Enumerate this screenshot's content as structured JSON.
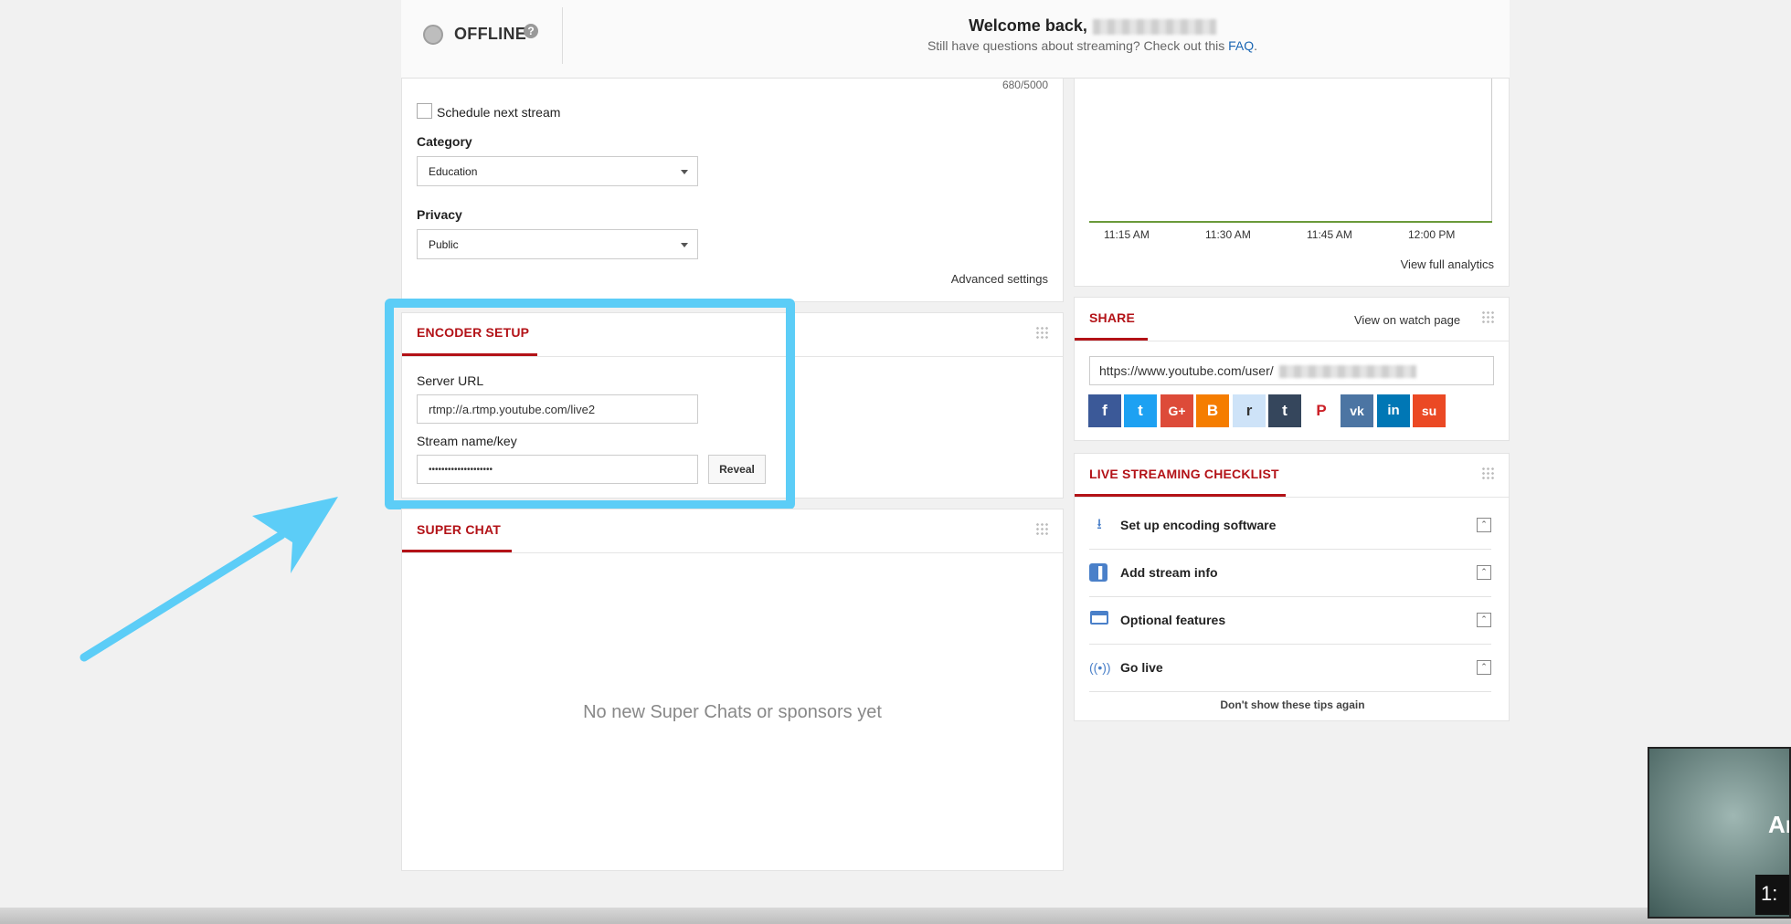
{
  "header": {
    "status": "OFFLINE",
    "help": "?",
    "welcome": "Welcome back,",
    "subtitle": "Still have questions about streaming? Check out this",
    "faq_link": "FAQ",
    "period": "."
  },
  "stream_info": {
    "char_count": "680/5000",
    "schedule_label": "Schedule next stream",
    "category_label": "Category",
    "category_value": "Education",
    "privacy_label": "Privacy",
    "privacy_value": "Public",
    "advanced_settings": "Advanced settings"
  },
  "analytics": {
    "time_ticks": [
      "11:15 AM",
      "11:30 AM",
      "11:45 AM",
      "12:00 PM"
    ],
    "view_full": "View full analytics"
  },
  "encoder": {
    "title": "ENCODER SETUP",
    "server_url_label": "Server URL",
    "server_url_value": "rtmp://a.rtmp.youtube.com/live2",
    "stream_key_label": "Stream name/key",
    "stream_key_value": "••••••••••••••••••••",
    "reveal_button": "Reveal"
  },
  "super_chat": {
    "title": "SUPER CHAT",
    "empty_message": "No new Super Chats or sponsors yet"
  },
  "share": {
    "title": "SHARE",
    "view_on_watch_page": "View on watch page",
    "url": "https://www.youtube.com/user/",
    "buttons": [
      {
        "name": "facebook",
        "glyph": "f",
        "color": "#3b5998"
      },
      {
        "name": "twitter",
        "glyph": "t",
        "color": "#1da1f2"
      },
      {
        "name": "google-plus",
        "glyph": "G+",
        "color": "#dd4b39"
      },
      {
        "name": "blogger",
        "glyph": "B",
        "color": "#f57d00"
      },
      {
        "name": "reddit",
        "glyph": "r",
        "color": "#cee3f8"
      },
      {
        "name": "tumblr",
        "glyph": "t",
        "color": "#35465c"
      },
      {
        "name": "pinterest",
        "glyph": "P",
        "color": "#ffffff"
      },
      {
        "name": "vk",
        "glyph": "vk",
        "color": "#4c75a3"
      },
      {
        "name": "linkedin",
        "glyph": "in",
        "color": "#0077b5"
      },
      {
        "name": "stumbleupon",
        "glyph": "su",
        "color": "#eb4924"
      }
    ]
  },
  "checklist": {
    "title": "LIVE STREAMING CHECKLIST",
    "items": [
      {
        "label": "Set up encoding software",
        "icon": "download-icon"
      },
      {
        "label": "Add stream info",
        "icon": "chart-icon"
      },
      {
        "label": "Optional features",
        "icon": "card-icon"
      },
      {
        "label": "Go live",
        "icon": "broadcast-icon"
      }
    ],
    "dismiss": "Don't show these tips again"
  },
  "overlay": {
    "thumb_text": "Ar",
    "timestamp": "1:"
  },
  "colors": {
    "accent_red": "#b31217",
    "highlight_blue": "#5ccdf7",
    "link_blue": "#1a66b3"
  }
}
